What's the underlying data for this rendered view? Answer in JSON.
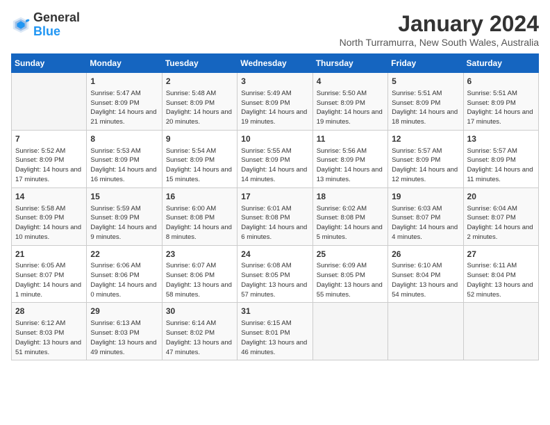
{
  "logo": {
    "line1": "General",
    "line2": "Blue"
  },
  "title": "January 2024",
  "subtitle": "North Turramurra, New South Wales, Australia",
  "weekdays": [
    "Sunday",
    "Monday",
    "Tuesday",
    "Wednesday",
    "Thursday",
    "Friday",
    "Saturday"
  ],
  "weeks": [
    [
      {
        "day": "",
        "info": ""
      },
      {
        "day": "1",
        "info": "Sunrise: 5:47 AM\nSunset: 8:09 PM\nDaylight: 14 hours\nand 21 minutes."
      },
      {
        "day": "2",
        "info": "Sunrise: 5:48 AM\nSunset: 8:09 PM\nDaylight: 14 hours\nand 20 minutes."
      },
      {
        "day": "3",
        "info": "Sunrise: 5:49 AM\nSunset: 8:09 PM\nDaylight: 14 hours\nand 19 minutes."
      },
      {
        "day": "4",
        "info": "Sunrise: 5:50 AM\nSunset: 8:09 PM\nDaylight: 14 hours\nand 19 minutes."
      },
      {
        "day": "5",
        "info": "Sunrise: 5:51 AM\nSunset: 8:09 PM\nDaylight: 14 hours\nand 18 minutes."
      },
      {
        "day": "6",
        "info": "Sunrise: 5:51 AM\nSunset: 8:09 PM\nDaylight: 14 hours\nand 17 minutes."
      }
    ],
    [
      {
        "day": "7",
        "info": "Sunrise: 5:52 AM\nSunset: 8:09 PM\nDaylight: 14 hours\nand 17 minutes."
      },
      {
        "day": "8",
        "info": "Sunrise: 5:53 AM\nSunset: 8:09 PM\nDaylight: 14 hours\nand 16 minutes."
      },
      {
        "day": "9",
        "info": "Sunrise: 5:54 AM\nSunset: 8:09 PM\nDaylight: 14 hours\nand 15 minutes."
      },
      {
        "day": "10",
        "info": "Sunrise: 5:55 AM\nSunset: 8:09 PM\nDaylight: 14 hours\nand 14 minutes."
      },
      {
        "day": "11",
        "info": "Sunrise: 5:56 AM\nSunset: 8:09 PM\nDaylight: 14 hours\nand 13 minutes."
      },
      {
        "day": "12",
        "info": "Sunrise: 5:57 AM\nSunset: 8:09 PM\nDaylight: 14 hours\nand 12 minutes."
      },
      {
        "day": "13",
        "info": "Sunrise: 5:57 AM\nSunset: 8:09 PM\nDaylight: 14 hours\nand 11 minutes."
      }
    ],
    [
      {
        "day": "14",
        "info": "Sunrise: 5:58 AM\nSunset: 8:09 PM\nDaylight: 14 hours\nand 10 minutes."
      },
      {
        "day": "15",
        "info": "Sunrise: 5:59 AM\nSunset: 8:09 PM\nDaylight: 14 hours\nand 9 minutes."
      },
      {
        "day": "16",
        "info": "Sunrise: 6:00 AM\nSunset: 8:08 PM\nDaylight: 14 hours\nand 8 minutes."
      },
      {
        "day": "17",
        "info": "Sunrise: 6:01 AM\nSunset: 8:08 PM\nDaylight: 14 hours\nand 6 minutes."
      },
      {
        "day": "18",
        "info": "Sunrise: 6:02 AM\nSunset: 8:08 PM\nDaylight: 14 hours\nand 5 minutes."
      },
      {
        "day": "19",
        "info": "Sunrise: 6:03 AM\nSunset: 8:07 PM\nDaylight: 14 hours\nand 4 minutes."
      },
      {
        "day": "20",
        "info": "Sunrise: 6:04 AM\nSunset: 8:07 PM\nDaylight: 14 hours\nand 2 minutes."
      }
    ],
    [
      {
        "day": "21",
        "info": "Sunrise: 6:05 AM\nSunset: 8:07 PM\nDaylight: 14 hours\nand 1 minute."
      },
      {
        "day": "22",
        "info": "Sunrise: 6:06 AM\nSunset: 8:06 PM\nDaylight: 14 hours\nand 0 minutes."
      },
      {
        "day": "23",
        "info": "Sunrise: 6:07 AM\nSunset: 8:06 PM\nDaylight: 13 hours\nand 58 minutes."
      },
      {
        "day": "24",
        "info": "Sunrise: 6:08 AM\nSunset: 8:05 PM\nDaylight: 13 hours\nand 57 minutes."
      },
      {
        "day": "25",
        "info": "Sunrise: 6:09 AM\nSunset: 8:05 PM\nDaylight: 13 hours\nand 55 minutes."
      },
      {
        "day": "26",
        "info": "Sunrise: 6:10 AM\nSunset: 8:04 PM\nDaylight: 13 hours\nand 54 minutes."
      },
      {
        "day": "27",
        "info": "Sunrise: 6:11 AM\nSunset: 8:04 PM\nDaylight: 13 hours\nand 52 minutes."
      }
    ],
    [
      {
        "day": "28",
        "info": "Sunrise: 6:12 AM\nSunset: 8:03 PM\nDaylight: 13 hours\nand 51 minutes."
      },
      {
        "day": "29",
        "info": "Sunrise: 6:13 AM\nSunset: 8:03 PM\nDaylight: 13 hours\nand 49 minutes."
      },
      {
        "day": "30",
        "info": "Sunrise: 6:14 AM\nSunset: 8:02 PM\nDaylight: 13 hours\nand 47 minutes."
      },
      {
        "day": "31",
        "info": "Sunrise: 6:15 AM\nSunset: 8:01 PM\nDaylight: 13 hours\nand 46 minutes."
      },
      {
        "day": "",
        "info": ""
      },
      {
        "day": "",
        "info": ""
      },
      {
        "day": "",
        "info": ""
      }
    ]
  ]
}
